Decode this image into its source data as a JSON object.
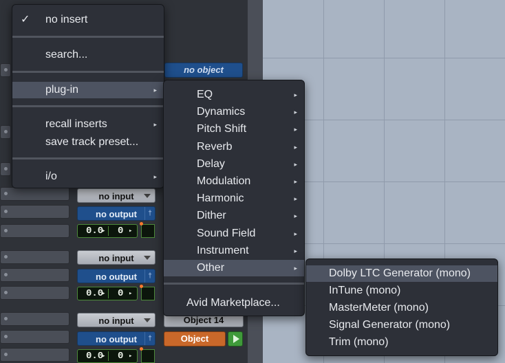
{
  "colors": {
    "menu_bg": "#2d3038",
    "highlight": "#4d5361",
    "output_blue": "#1f4f8c",
    "object_orange": "#c9682a",
    "grid": "#a9b4c3"
  },
  "insert_menu": {
    "items": [
      {
        "label": "no insert",
        "checked": true
      },
      {
        "label": "search..."
      },
      {
        "label": "plug-in",
        "has_submenu": true,
        "highlighted": true
      },
      {
        "label": "recall inserts",
        "has_submenu": true
      },
      {
        "label": "save track preset..."
      },
      {
        "label": "i/o",
        "has_submenu": true
      }
    ]
  },
  "plugin_menu": {
    "items": [
      "EQ",
      "Dynamics",
      "Pitch Shift",
      "Reverb",
      "Delay",
      "Modulation",
      "Harmonic",
      "Dither",
      "Sound Field",
      "Instrument",
      "Other"
    ],
    "highlighted": "Other",
    "footer": "Avid Marketplace..."
  },
  "other_menu": {
    "items": [
      "Dolby LTC Generator (mono)",
      "InTune (mono)",
      "MasterMeter (mono)",
      "Signal Generator (mono)",
      "Trim (mono)"
    ],
    "highlighted": "Dolby LTC Generator (mono)"
  },
  "mixer": {
    "no_object": "no object",
    "channels": [
      {
        "input": "no input",
        "output": "no output",
        "vol": "0.0",
        "pan": "0"
      },
      {
        "input": "no input",
        "output": "no output",
        "vol": "0.0",
        "pan": "0"
      },
      {
        "input": "no input",
        "output": "no output",
        "vol": "0.0",
        "pan": "0"
      }
    ],
    "object_name": "Object 14",
    "object_button": "Object"
  },
  "icons": {
    "check": "checkmark-icon",
    "submenu": "triangle-right-icon",
    "pin": "pin-icon",
    "dropdown": "triangle-down-icon",
    "play": "play-icon"
  }
}
